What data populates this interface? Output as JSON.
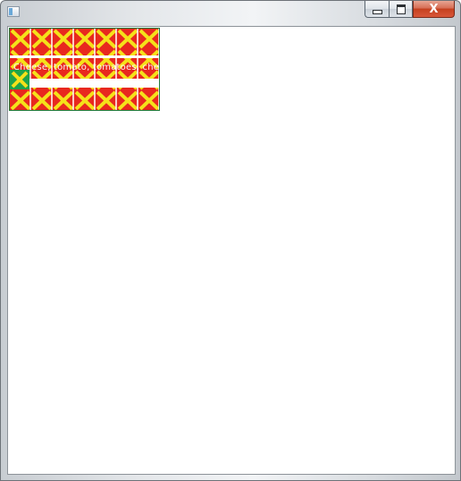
{
  "window": {
    "title": "",
    "buttons": {
      "minimize_icon": "minimize-icon",
      "maximize_icon": "maximize-icon",
      "close_label": "X"
    }
  },
  "canvas": {
    "overlay_text": "Cheese, tomato, tomatoes, cheese",
    "colors": {
      "tile_red": "#e8281f",
      "tile_yellow": "#f5e11a",
      "tile_green": "#1fa34a",
      "tile_white": "#ffffff"
    }
  }
}
